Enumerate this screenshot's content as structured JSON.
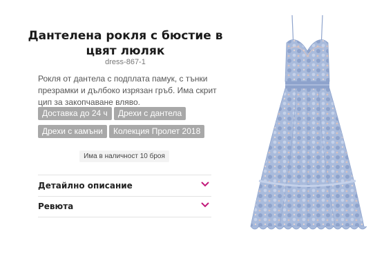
{
  "product": {
    "title": "Дантелена рокля с бюстие в цвят люляк",
    "sku": "dress-867-1",
    "description": "Рокля от дантела с подплата памук, с тънки презрамки и дълбоко изрязан гръб. Има скрит цип за закопчаване вляво.",
    "tags": [
      "Доставка до 24 ч",
      "Дрехи с дантела",
      "Дрехи с камъни",
      "Колекция Пролет 2018"
    ],
    "stock": "Има в наличност 10 броя"
  },
  "accordion": {
    "details_label": "Детайлно описание",
    "reviews_label": "Ревюта"
  },
  "image": {
    "icon": "lace-dress-image",
    "dress_color": "#9fb2d6",
    "lining_color": "#d9c3c0"
  },
  "colors": {
    "accent": "#c2187a",
    "tag_bg": "#a8a8a8"
  }
}
